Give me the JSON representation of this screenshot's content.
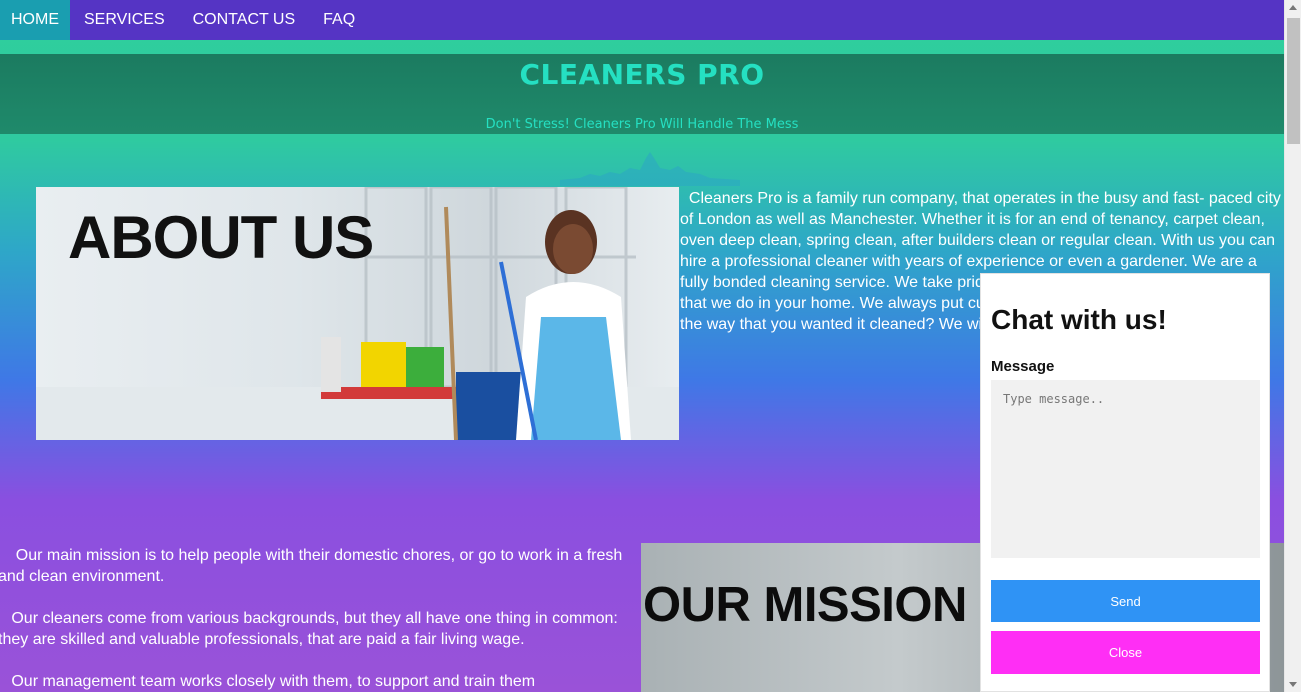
{
  "nav": {
    "items": [
      {
        "label": "HOME",
        "active": true
      },
      {
        "label": "SERVICES",
        "active": false
      },
      {
        "label": "CONTACT US",
        "active": false
      },
      {
        "label": "FAQ",
        "active": false
      }
    ]
  },
  "header": {
    "title": "CLEANERS PRO",
    "tagline": "Don't Stress! Cleaners Pro Will Handle The Mess"
  },
  "about": {
    "image_heading": "ABOUT US",
    "text": "  Cleaners Pro is a family run company, that operates in the busy and fast- paced city of London as well as Manchester. Whether it is for an end of tenancy, carpet clean, oven deep clean, spring clean, after builders clean or regular clean. With us you can hire a professional cleaner with years of experience or even a gardener. We are a fully bonded cleaning service. We take pride in our work and stand behind the work that we do in your home. We always put customer first. Was something not cleaned the way that you wanted it cleaned? We will do our best to put things right."
  },
  "mission": {
    "image_heading": "OUR MISSION",
    "paragraphs": [
      "    Our main mission is to help people with their domestic chores, or go to work in a fresh and clean environment.",
      "   Our cleaners come from various backgrounds, but they all have one thing in common: they are skilled and valuable professionals, that are paid a fair living wage.",
      "   Our management team works closely with them, to support and train them"
    ]
  },
  "chat": {
    "title": "Chat with us!",
    "message_label": "Message",
    "message_placeholder": "Type message..",
    "message_value": "",
    "send_label": "Send",
    "close_label": "Close"
  },
  "colors": {
    "nav_bg": "#5534c4",
    "nav_active": "#1a9eb0",
    "title": "#25e0c2",
    "send": "#2f93f5",
    "close": "#ff2ef5"
  }
}
